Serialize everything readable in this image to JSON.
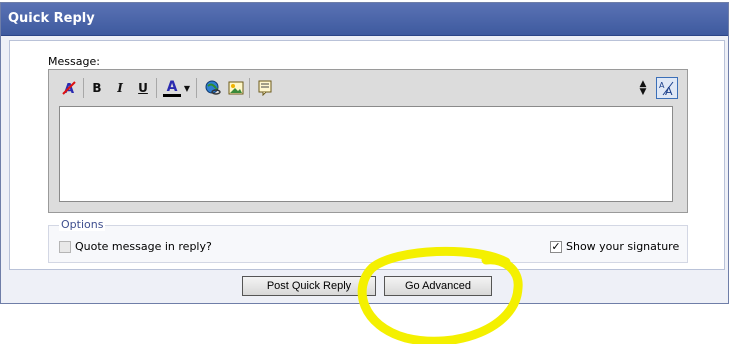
{
  "panel": {
    "title": "Quick Reply"
  },
  "message": {
    "label": "Message:",
    "value": "",
    "toolbar": {
      "bold": "B",
      "italic": "I",
      "underline": "U",
      "font_color": "A"
    }
  },
  "options": {
    "legend": "Options",
    "quote_label": "Quote message in reply?",
    "quote_checked": false,
    "signature_label": "Show your signature",
    "signature_checked": true,
    "check_glyph": "✓"
  },
  "buttons": {
    "post": "Post Quick Reply",
    "advanced": "Go Advanced"
  },
  "colors": {
    "title_bar": "#4a64a8",
    "annotation": "#f4f000"
  }
}
